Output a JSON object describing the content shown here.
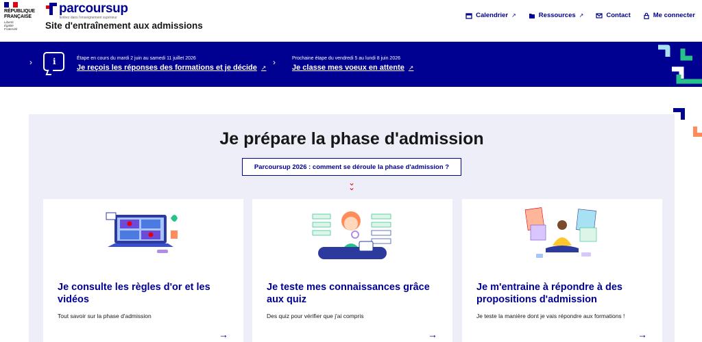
{
  "header": {
    "gov_name": "RÉPUBLIQUE\nFRANÇAISE",
    "gov_motto": "Liberté\nÉgalité\nFraternité",
    "brand": "parcoursup",
    "brand_tagline": "Entrez dans l'enseignement supérieur",
    "site_title": "Site d'entraînement aux admissions",
    "nav": [
      {
        "label": "Calendrier",
        "icon": "calendar-icon"
      },
      {
        "label": "Ressources",
        "icon": "folder-icon"
      },
      {
        "label": "Contact",
        "icon": "mail-icon"
      },
      {
        "label": "Me connecter",
        "icon": "lock-icon"
      }
    ]
  },
  "banner": {
    "current": {
      "caption": "Étape en cours du mardi 2 juin au samedi 11 juillet 2026",
      "link": "Je reçois les réponses des formations et je décide"
    },
    "next": {
      "caption": "Prochaine étape du vendredi 5 au lundi 8 juin 2026",
      "link": "Je classe mes voeux en attente"
    }
  },
  "main": {
    "title": "Je prépare la phase d'admission",
    "pill": "Parcoursup 2026 : comment se déroule la phase d'admission ?",
    "cards": [
      {
        "title": "Je consulte les règles d'or et les vidéos",
        "desc": "Tout savoir sur la phase d'admission"
      },
      {
        "title": "Je teste mes connaissances grâce aux quiz",
        "desc": "Des quiz pour vérifier que j'ai compris"
      },
      {
        "title": "Je m'entraine à répondre à des propositions d'admission",
        "desc": "Je teste la manière dont je vais répondre aux formations !"
      }
    ]
  },
  "colors": {
    "blue_france": "#000091",
    "red_marianne": "#e1000f",
    "panel_bg": "#eeeef8",
    "accent_green": "#27c28a",
    "accent_orange": "#ff8d5c",
    "accent_lightblue": "#a7e1f3"
  }
}
